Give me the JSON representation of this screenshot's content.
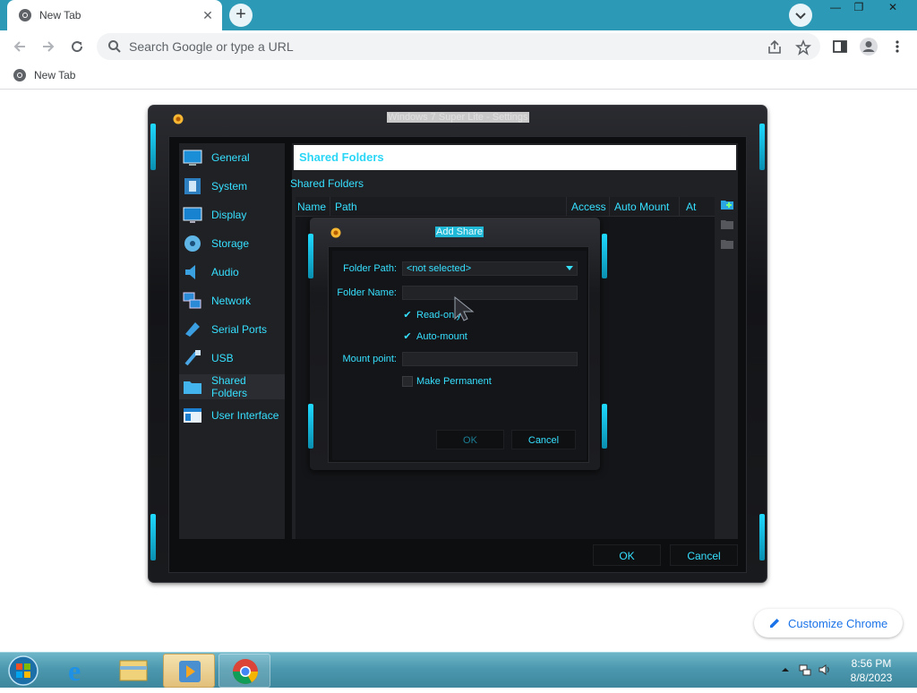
{
  "browser": {
    "tab": {
      "title": "New Tab",
      "close": "✕"
    },
    "new_tab_label": "+",
    "window_controls": {
      "minimize": "—",
      "restore": "❐",
      "close": "✕"
    },
    "omnibox": {
      "placeholder": "Search Google or type a URL"
    },
    "bookmarks": [
      {
        "label": "New Tab"
      }
    ],
    "customize": {
      "label": "Customize Chrome"
    },
    "colors": {
      "tabstrip": "#2c9ab7",
      "link": "#1a73e8"
    }
  },
  "settings_window": {
    "title": "Windows 7 Super Lite - Settings",
    "sidebar": [
      {
        "label": "General",
        "icon": "general-icon"
      },
      {
        "label": "System",
        "icon": "system-icon"
      },
      {
        "label": "Display",
        "icon": "display-icon"
      },
      {
        "label": "Storage",
        "icon": "storage-icon"
      },
      {
        "label": "Audio",
        "icon": "audio-icon"
      },
      {
        "label": "Network",
        "icon": "network-icon"
      },
      {
        "label": "Serial Ports",
        "icon": "serial-ports-icon"
      },
      {
        "label": "USB",
        "icon": "usb-icon"
      },
      {
        "label": "Shared Folders",
        "icon": "shared-folders-icon",
        "selected": true
      },
      {
        "label": "User Interface",
        "icon": "user-interface-icon"
      }
    ],
    "header": "Shared Folders",
    "section_label": "Shared Folders",
    "table_columns": [
      "Name",
      "Path",
      "Access",
      "Auto Mount",
      "At"
    ],
    "buttons": {
      "ok": "OK",
      "cancel": "Cancel"
    },
    "accent_color": "#36e0ff"
  },
  "add_share_dialog": {
    "title": "Add Share",
    "folder_path_label": "Folder Path:",
    "folder_path_value": "<not selected>",
    "folder_name_label": "Folder Name:",
    "folder_name_value": "",
    "read_only_label": "Read-only",
    "read_only_checked": true,
    "auto_mount_label": "Auto-mount",
    "auto_mount_checked": true,
    "mount_point_label": "Mount point:",
    "mount_point_value": "",
    "make_permanent_label": "Make Permanent",
    "make_permanent_checked": false,
    "ok_label": "OK",
    "cancel_label": "Cancel"
  },
  "taskbar": {
    "clock_time": "8:56 PM",
    "clock_date": "8/8/2023"
  }
}
